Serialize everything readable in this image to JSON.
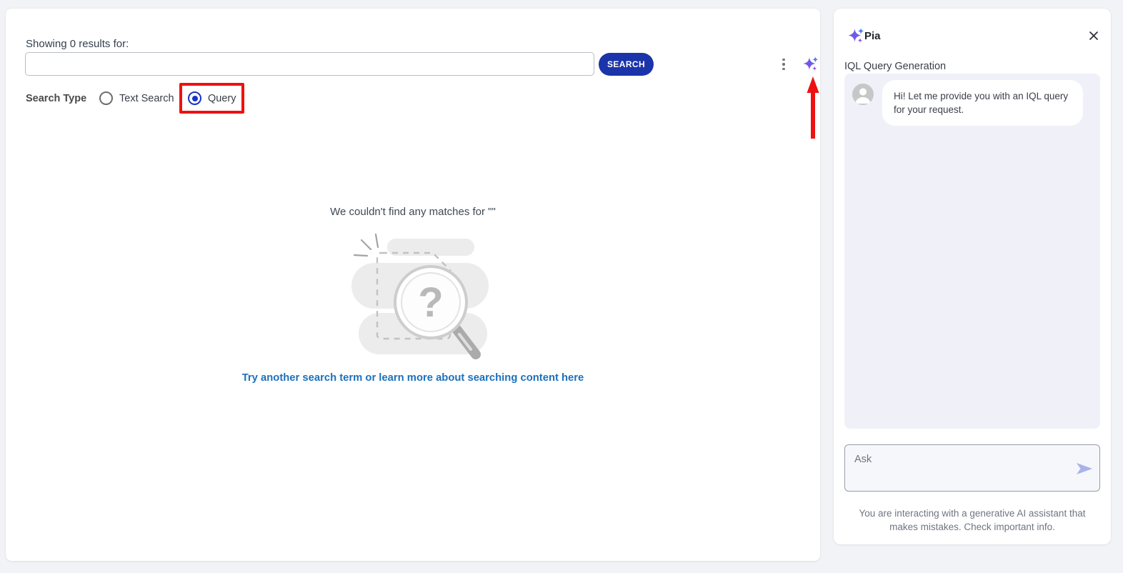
{
  "search_panel": {
    "results_label": "Showing 0 results for:",
    "search_input_value": "",
    "search_button_label": "SEARCH",
    "search_type": {
      "label": "Search Type",
      "option_text_search": "Text Search",
      "option_query": "Query",
      "selected_option": "Query"
    },
    "empty_state": {
      "message": "We couldn't find any matches for \"\"",
      "link_text": "Try another search term or learn more about searching content here"
    }
  },
  "assistant_panel": {
    "title": "Pia",
    "subtitle": "IQL Query Generation",
    "greeting": "Hi! Let me provide you with an IQL query for your request.",
    "ask_placeholder": "Ask",
    "disclaimer": "You are interacting with a generative AI assistant that makes mistakes. Check important info."
  },
  "icons": {
    "sparkles": "ai-sparkles",
    "kebab": "vertical-dots-menu",
    "close": "close-x",
    "send": "send-arrow",
    "avatar": "bot-person-avatar",
    "empty_illustration": "magnifier-question-no-results"
  },
  "colors": {
    "search_button_bg": "#1b34a9",
    "radio_selected": "#1733c4",
    "link_blue": "#1c70bd",
    "sparkle_purple": "#7059e8",
    "sparkle_blue": "#4a7bf0",
    "sparkle_violet": "#9050ee",
    "annotation_red": "#ee1111",
    "send_arrow": "#a9b2e9",
    "chat_area_bg": "#f0f1f8"
  }
}
